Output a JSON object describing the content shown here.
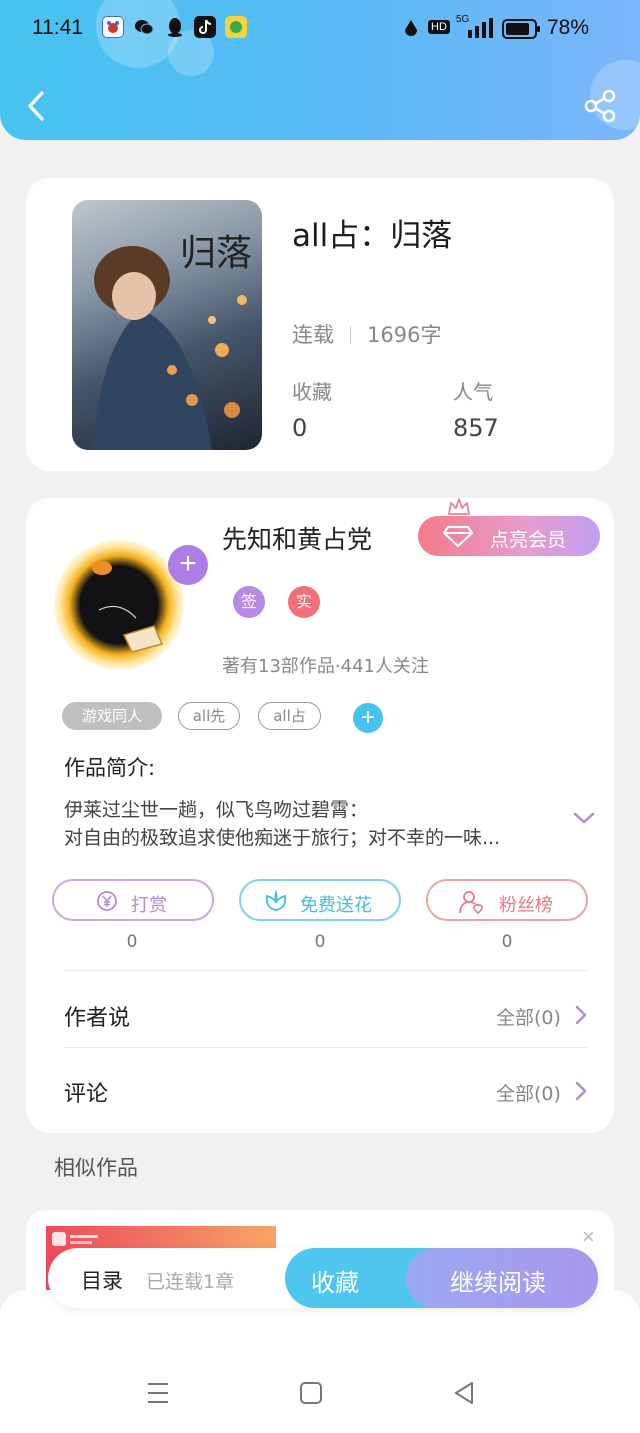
{
  "status_bar": {
    "time": "11:41",
    "battery": "78%",
    "network": "5G",
    "hd": "HD"
  },
  "header": {
    "back_icon": "chevron-left-icon",
    "share_icon": "share-icon"
  },
  "book": {
    "title": "all占：归落",
    "cover_text": "归落",
    "status": "连载",
    "word_count": "1696字",
    "favorites_label": "收藏",
    "favorites_value": "0",
    "popularity_label": "人气",
    "popularity_value": "857"
  },
  "author": {
    "name": "先知和黄占党",
    "vip_label": "点亮会员",
    "follow_plus": "+",
    "badge_sign": "签",
    "badge_real": "实",
    "works_info": "著有13部作品·441人关注",
    "tags": [
      "游戏同人",
      "all先",
      "all占"
    ],
    "add_tag": "+"
  },
  "intro": {
    "title": "作品简介:",
    "line1": "伊莱过尘世一趟，似飞鸟吻过碧霄：",
    "line2": "对自由的极致追求使他痴迷于旅行；对不幸的一味..."
  },
  "actions": [
    {
      "label": "打赏",
      "count": "0",
      "icon": "yen-coin-icon"
    },
    {
      "label": "免费送花",
      "count": "0",
      "icon": "flower-icon"
    },
    {
      "label": "粉丝榜",
      "count": "0",
      "icon": "fan-user-icon"
    }
  ],
  "rows": {
    "author_says": {
      "label": "作者说",
      "right": "全部(0)"
    },
    "comments": {
      "label": "评论",
      "right": "全部(0)"
    }
  },
  "similar": {
    "title": "相似作品",
    "close": "×"
  },
  "bottom": {
    "toc": "目录",
    "chapters": "已连载1章",
    "favorite": "收藏",
    "continue": "继续阅读"
  },
  "colors": {
    "header_blue": "#46c4f0",
    "accent_purple": "#ad7ce4",
    "accent_cyan": "#48c2ee",
    "vip_pink": "#f37b87"
  }
}
